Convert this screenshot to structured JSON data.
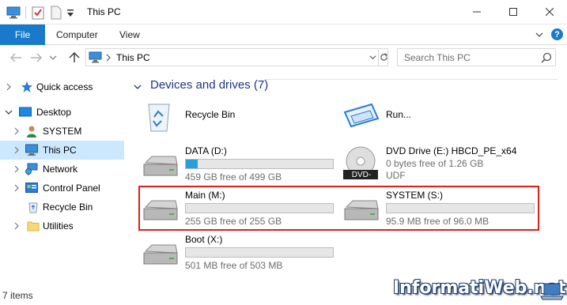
{
  "window": {
    "title": "This PC",
    "icons": [
      "pc-icon",
      "properties-icon",
      "new-folder-icon",
      "customize-quick-access-icon"
    ],
    "controls": [
      "minimize-icon",
      "maximize-icon",
      "close-icon"
    ]
  },
  "ribbon": {
    "file_label": "File",
    "tabs": [
      "Computer",
      "View"
    ],
    "accent": "#1979ca",
    "help_label": "?"
  },
  "address": {
    "path": "This PC",
    "search_placeholder": "Search This PC"
  },
  "sidebar": {
    "items": [
      {
        "label": "Quick access",
        "icon": "star-icon"
      },
      {
        "label": "Desktop",
        "icon": "desktop-icon"
      },
      {
        "label": "SYSTEM",
        "icon": "user-icon"
      },
      {
        "label": "This PC",
        "icon": "pc-icon",
        "selected": true
      },
      {
        "label": "Network",
        "icon": "network-icon"
      },
      {
        "label": "Control Panel",
        "icon": "control-panel-icon"
      },
      {
        "label": "Recycle Bin",
        "icon": "recycle-bin-icon"
      },
      {
        "label": "Utilities",
        "icon": "folder-icon"
      }
    ]
  },
  "main": {
    "section_title": "Devices and drives (7)",
    "items": [
      {
        "name": "Recycle Bin",
        "icon": "recycle-bin-icon"
      },
      {
        "name": "Run...",
        "icon": "run-icon"
      },
      {
        "name": "DATA (D:)",
        "free": "459 GB free of 499 GB",
        "used_fraction": 0.08
      },
      {
        "name": "DVD Drive (E:) HBCD_PE_x64",
        "free": "0 bytes free of 1.26 GB",
        "fs": "UDF",
        "badge": "DVD-ROM"
      },
      {
        "name": "Main (M:)",
        "free": "255 GB free of 255 GB",
        "used_fraction": 0.0
      },
      {
        "name": "SYSTEM (S:)",
        "free": "95.9 MB free of 96.0 MB",
        "used_fraction": 0.0
      },
      {
        "name": "Boot (X:)",
        "free": "501 MB free of 503 MB",
        "used_fraction": 0.0
      }
    ],
    "highlight_color": "#e01e1e",
    "bar_fill_color": "#26a0da"
  },
  "status": {
    "items_count": "7 items"
  },
  "watermark": {
    "text": "InformatiWeb.net"
  }
}
